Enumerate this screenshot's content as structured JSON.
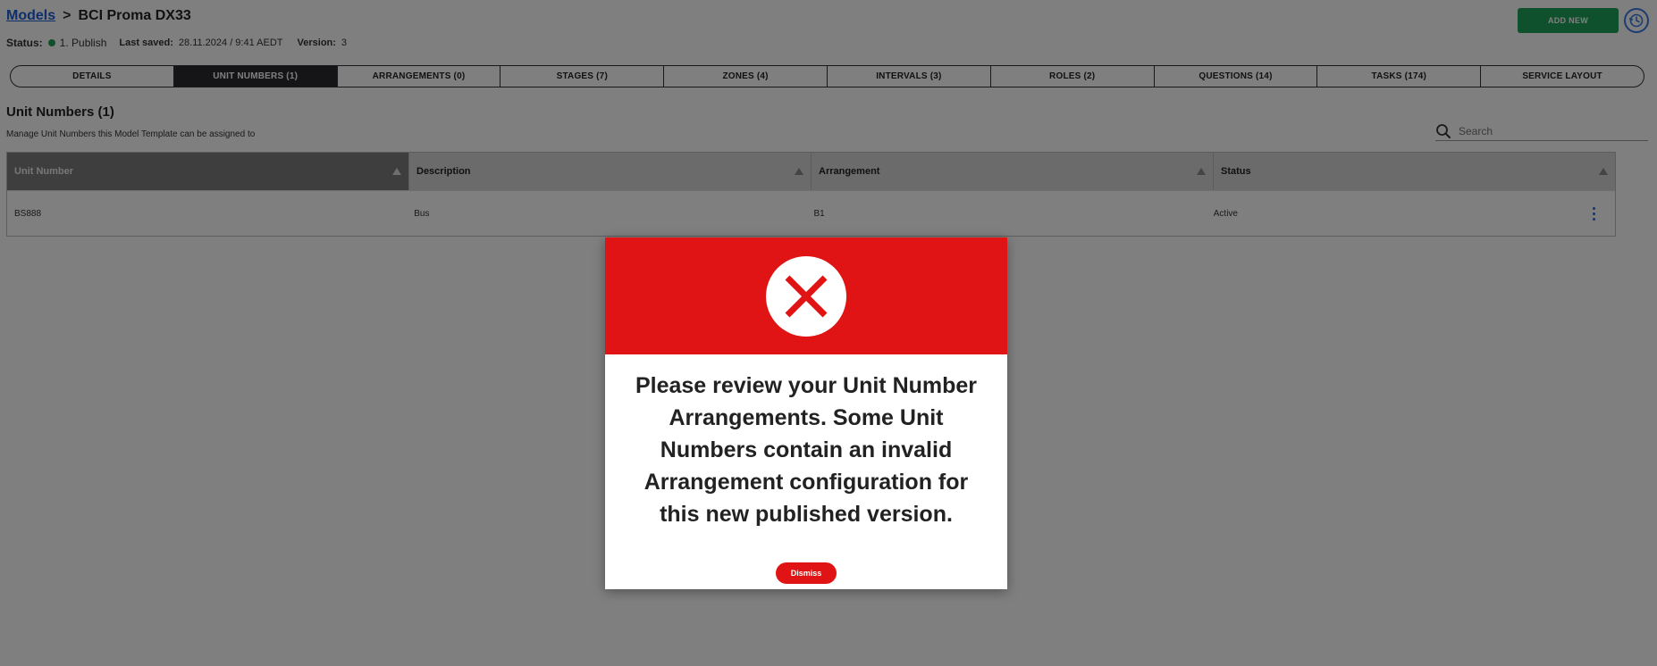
{
  "breadcrumb": {
    "link": "Models",
    "separator": ">",
    "title": "BCI Proma DX33"
  },
  "status": {
    "label": "Status:",
    "value": "1. Publish",
    "last_saved_label": "Last saved:",
    "last_saved_value": "28.11.2024 / 9:41 AEDT",
    "version_label": "Version:",
    "version_value": "3",
    "dot_color": "#1e9e56"
  },
  "actions": {
    "add_new": "ADD NEW",
    "history_icon": "history-icon"
  },
  "tabs": [
    {
      "label": "DETAILS"
    },
    {
      "label": "UNIT NUMBERS (1)",
      "active": true
    },
    {
      "label": "ARRANGEMENTS (0)"
    },
    {
      "label": "STAGES (7)"
    },
    {
      "label": "ZONES (4)"
    },
    {
      "label": "INTERVALS (3)"
    },
    {
      "label": "ROLES (2)"
    },
    {
      "label": "QUESTIONS (14)"
    },
    {
      "label": "TASKS (174)"
    },
    {
      "label": "SERVICE LAYOUT"
    }
  ],
  "section": {
    "title": "Unit Numbers (1)",
    "subtitle": "Manage Unit Numbers this Model Template can be assigned to"
  },
  "search": {
    "placeholder": "Search",
    "value": ""
  },
  "table": {
    "columns": [
      "Unit Number",
      "Description",
      "Arrangement",
      "Status"
    ],
    "rows": [
      [
        "BS888",
        "Bus",
        "B1",
        "Active"
      ]
    ]
  },
  "modal": {
    "icon": "error-x-icon",
    "message": "Please review your Unit Number Arrangements. Some Unit Numbers contain an invalid Arrangement configuration for this new published version.",
    "dismiss_label": "Dismiss"
  },
  "colors": {
    "accent_green": "#1ea35a",
    "error_red": "#e01414",
    "link_blue": "#1a5fd6",
    "active_tab": "#2b2b2f"
  }
}
